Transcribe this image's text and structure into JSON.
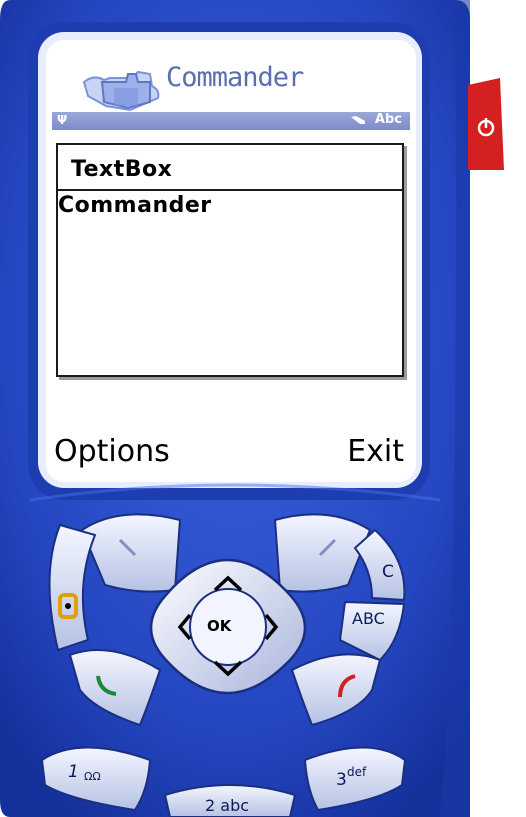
{
  "app": {
    "title": "Commander"
  },
  "status": {
    "signal_icon": "antenna-icon",
    "input_mode": "Abc",
    "pen_icon": "pen-icon"
  },
  "textbox": {
    "label": "TextBox",
    "value": "Commander"
  },
  "softkeys": {
    "left": "Options",
    "right": "Exit"
  },
  "keys": {
    "ok": "OK",
    "clear": "C",
    "abc": "ABC",
    "key1": "1",
    "key1_sub": "ΩΩ",
    "key2": "2 abc",
    "key3": "3",
    "key3_sub": "def"
  },
  "colors": {
    "body": "#2c50c8",
    "body_dark": "#1230a0",
    "screen_frame": "#dde6ff",
    "status_bar": "#8595d2",
    "power_button": "#d42020"
  }
}
